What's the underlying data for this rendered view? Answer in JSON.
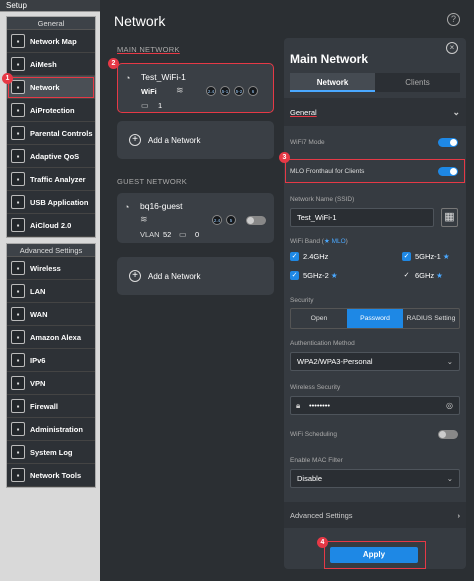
{
  "sidebar": {
    "top_label": "Setup",
    "general_title": "General",
    "general_items": [
      {
        "label": "Network Map",
        "icon": "network-map-icon"
      },
      {
        "label": "AiMesh",
        "icon": "mesh-icon"
      },
      {
        "label": "Network",
        "icon": "network-icon"
      },
      {
        "label": "AiProtection",
        "icon": "shield-icon"
      },
      {
        "label": "Parental Controls",
        "icon": "parental-icon"
      },
      {
        "label": "Adaptive QoS",
        "icon": "qos-icon"
      },
      {
        "label": "Traffic Analyzer",
        "icon": "traffic-icon"
      },
      {
        "label": "USB Application",
        "icon": "usb-icon"
      },
      {
        "label": "AiCloud 2.0",
        "icon": "cloud-icon"
      }
    ],
    "advanced_title": "Advanced Settings",
    "advanced_items": [
      {
        "label": "Wireless",
        "icon": "wireless-icon"
      },
      {
        "label": "LAN",
        "icon": "lan-icon"
      },
      {
        "label": "WAN",
        "icon": "wan-icon"
      },
      {
        "label": "Amazon Alexa",
        "icon": "alexa-icon"
      },
      {
        "label": "IPv6",
        "icon": "ipv6-icon"
      },
      {
        "label": "VPN",
        "icon": "vpn-icon"
      },
      {
        "label": "Firewall",
        "icon": "firewall-icon"
      },
      {
        "label": "Administration",
        "icon": "admin-icon"
      },
      {
        "label": "System Log",
        "icon": "log-icon"
      },
      {
        "label": "Network Tools",
        "icon": "tools-icon"
      }
    ]
  },
  "main": {
    "title": "Network",
    "main_network_label": "MAIN NETWORK",
    "main_card": {
      "ssid": "Test_WiFi-1",
      "type": "WiFi",
      "bands": [
        "2.4",
        "5-1",
        "5-2",
        "6"
      ],
      "devices": "1"
    },
    "add_network": "Add a Network",
    "guest_network_label": "GUEST NETWORK",
    "guest_card": {
      "ssid": "bq16-guest",
      "bands": [
        "2.4",
        "5"
      ],
      "vlan_label": "VLAN",
      "vlan": "52",
      "devices": "0"
    }
  },
  "panel": {
    "title": "Main Network",
    "tabs": [
      "Network",
      "Clients"
    ],
    "general_label": "General",
    "wifi7_label": "WiFi7 Mode",
    "mlo_label": "MLO Fronthaul for Clients",
    "ssid_label": "Network Name (SSID)",
    "ssid_value": "Test_WiFi-1",
    "band_label": "WiFi Band (",
    "band_mlo": "★ MLO",
    "band_close": ")",
    "bands": {
      "b24": "2.4GHz",
      "b51": "5GHz-1",
      "b52": "5GHz-2",
      "b6": "6GHz"
    },
    "security_label": "Security",
    "security_options": [
      "Open",
      "Password",
      "RADIUS Setting"
    ],
    "auth_label": "Authentication Method",
    "auth_value": "WPA2/WPA3-Personal",
    "wsec_label": "Wireless Security",
    "wsec_value": "••••••••",
    "sched_label": "WiFi Scheduling",
    "mac_label": "Enable MAC Filter",
    "mac_value": "Disable",
    "advanced_label": "Advanced Settings",
    "apply_label": "Apply"
  },
  "markers": [
    "1",
    "2",
    "3",
    "4"
  ],
  "colors": {
    "accent": "#1e88e5",
    "highlight": "#e63946"
  }
}
